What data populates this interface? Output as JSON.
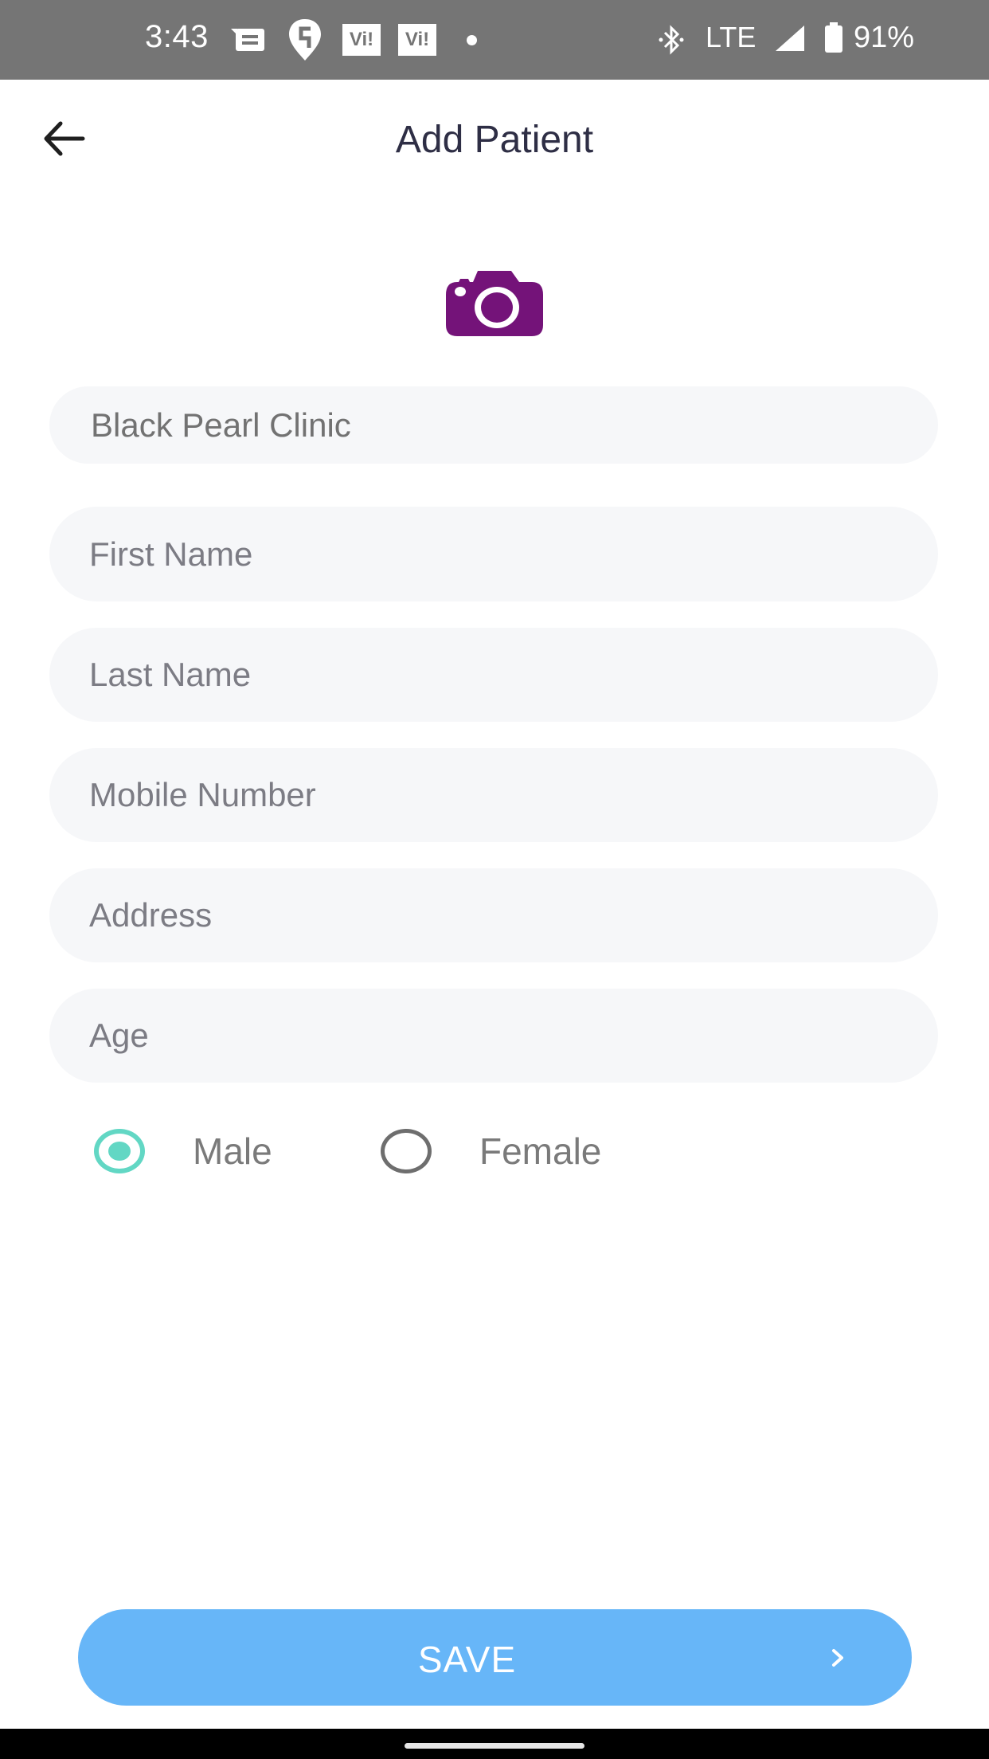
{
  "status_bar": {
    "time": "3:43",
    "icons": [
      "message-icon",
      "swiggy-icon",
      "vi-icon",
      "vi-icon",
      "dot-icon",
      "bluetooth-icon",
      "signal-icon",
      "battery-icon"
    ],
    "vi_label": "Vi!",
    "network": "LTE",
    "battery": "91%"
  },
  "header": {
    "back_icon": "arrow-left-icon",
    "title": "Add Patient"
  },
  "photo": {
    "icon": "camera-icon",
    "color": "#741379"
  },
  "form": {
    "clinic": {
      "value": "Black Pearl Clinic"
    },
    "first_name": {
      "value": "",
      "placeholder": "First Name"
    },
    "last_name": {
      "value": "",
      "placeholder": "Last Name"
    },
    "mobile": {
      "value": "",
      "placeholder": "Mobile Number"
    },
    "address": {
      "value": "",
      "placeholder": "Address"
    },
    "age": {
      "value": "",
      "placeholder": "Age"
    },
    "gender": {
      "options": [
        {
          "label": "Male",
          "selected": true
        },
        {
          "label": "Female",
          "selected": false
        }
      ]
    }
  },
  "save_button": {
    "label": "SAVE",
    "icon": "chevron-right-icon",
    "color": "#67b6f8"
  },
  "colors": {
    "accent_radio": "#62d7c4",
    "field_background": "#f6f7f9",
    "title_text": "#2e2e45"
  }
}
